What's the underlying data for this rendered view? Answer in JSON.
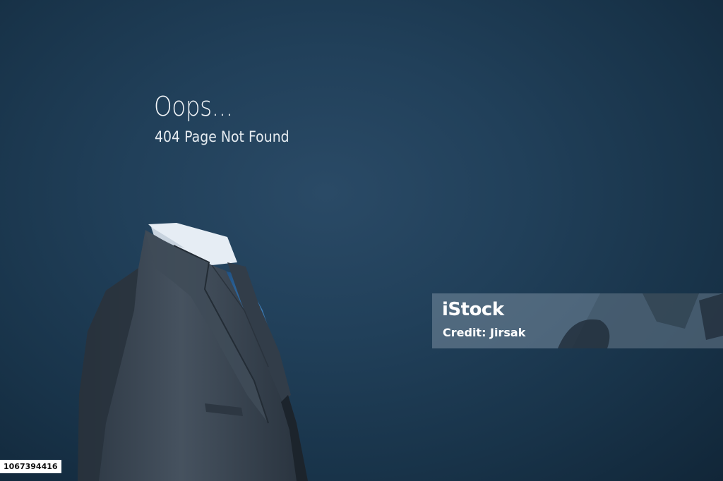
{
  "headline": "Oops...",
  "subline": "404 Page Not Found",
  "watermark": {
    "brand": "iStock",
    "credit": "Credit: Jirsak"
  },
  "image_id": "1067394416",
  "colors": {
    "background": "#1e3a52",
    "suit": "#3b4754",
    "shirt": "#e8eef4",
    "tie": "#2f6fa8"
  }
}
